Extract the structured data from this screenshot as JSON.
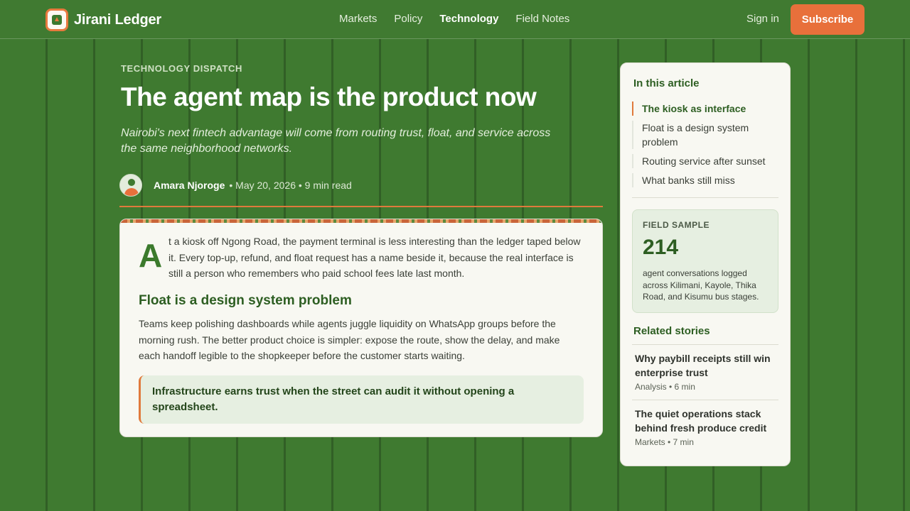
{
  "brand": {
    "name": "Jirani Ledger"
  },
  "nav": {
    "items": [
      "Markets",
      "Policy",
      "Technology",
      "Field Notes"
    ],
    "active": "Technology"
  },
  "account": {
    "signin": "Sign in",
    "subscribe": "Subscribe"
  },
  "colors": {
    "header_green": "#407a31",
    "accent_orange": "#e8703b",
    "card_bg": "#f8f8f2",
    "heading_green": "#2d5e22"
  },
  "article": {
    "kicker": "TECHNOLOGY DISPATCH",
    "headline": "The agent map is the product now",
    "dek": "Nairobi's next fintech advantage will come from routing trust, float, and service across the same neighborhood networks.",
    "author": "Amara Njoroge",
    "meta": "• May 20, 2026 • 9 min read",
    "dropcap": "A",
    "lede": "t a kiosk off Ngong Road, the payment terminal is less interesting than the ledger taped below it. Every top-up, refund, and float request has a name beside it, because the real interface is still a person who remembers who paid school fees late last month.",
    "section_heading": "Float is a design system problem",
    "section_body": "Teams keep polishing dashboards while agents juggle liquidity on WhatsApp groups before the morning rush. The better product choice is simpler: expose the route, show the delay, and make each handoff legible to the shopkeeper before the customer starts waiting.",
    "pullquote": "Infrastructure earns trust when the street can audit it without opening a spreadsheet."
  },
  "sidebar": {
    "toc_title": "In this article",
    "toc": [
      {
        "label": "The kiosk as interface",
        "active": true
      },
      {
        "label": "Float is a design system problem",
        "active": false
      },
      {
        "label": "Routing service after sunset",
        "active": false
      },
      {
        "label": "What banks still miss",
        "active": false
      }
    ],
    "sample": {
      "label": "FIELD SAMPLE",
      "value": "214",
      "description": "agent conversations logged across Kilimani, Kayole, Thika Road, and Kisumu bus stages."
    },
    "related_title": "Related stories",
    "related": [
      {
        "title": "Why paybill receipts still win enterprise trust",
        "meta": "Analysis • 6 min"
      },
      {
        "title": "The quiet operations stack behind fresh produce credit",
        "meta": "Markets • 7 min"
      }
    ]
  }
}
